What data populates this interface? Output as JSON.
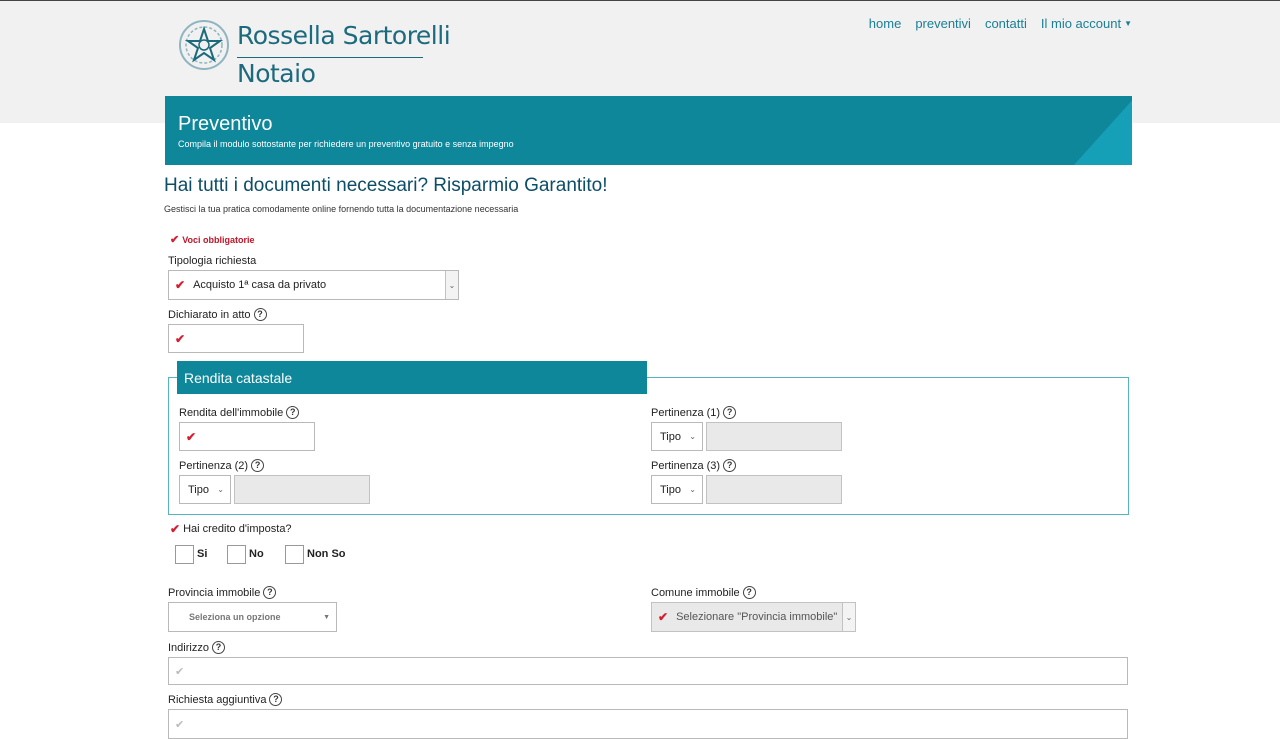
{
  "brand": {
    "name_line1": "Rossella Sartorelli",
    "name_line2": "Notaio"
  },
  "nav": {
    "items": [
      "home",
      "preventivi",
      "contatti",
      "Il mio account"
    ]
  },
  "banner": {
    "title": "Preventivo",
    "subtitle": "Compila il modulo sottostante per richiedere un preventivo gratuito e senza impegno"
  },
  "intro": {
    "headline": "Hai tutti i documenti necessari? Risparmio Garantito!",
    "subline": "Gestisci la tua pratica comodamente online fornendo tutta la documentazione necessaria"
  },
  "form": {
    "required_note": "Voci obbligatorie",
    "tipologia": {
      "label": "Tipologia richiesta",
      "value": "Acquisto 1ª casa da privato"
    },
    "dichiarato": {
      "label": "Dichiarato in atto",
      "value": ""
    },
    "rendita": {
      "legend": "Rendita catastale",
      "rendita_label": "Rendita dell'immobile",
      "pert1_label": "Pertinenza (1)",
      "pert2_label": "Pertinenza (2)",
      "pert3_label": "Pertinenza (3)",
      "tipo_label": "Tipo"
    },
    "credito": {
      "label": "Hai credito d'imposta?",
      "options": [
        "Si",
        "No",
        "Non So"
      ]
    },
    "provincia": {
      "label": "Provincia immobile",
      "placeholder": "Seleziona un opzione"
    },
    "comune": {
      "label": "Comune immobile",
      "placeholder": "Selezionare \"Provincia immobile\""
    },
    "indirizzo": {
      "label": "Indirizzo",
      "value": ""
    },
    "richiesta": {
      "label": "Richiesta aggiuntiva",
      "value": ""
    }
  },
  "colors": {
    "primary": "#0e879b",
    "stripe_light": "#1aa6c0",
    "stripe_mid": "#1496ad",
    "brand_text": "#1c6a7d",
    "required": "#d32030"
  },
  "icons": {
    "check": "check-icon",
    "help": "question-circle-icon",
    "caret": "caret-down-icon",
    "emblem": "republic-emblem"
  }
}
